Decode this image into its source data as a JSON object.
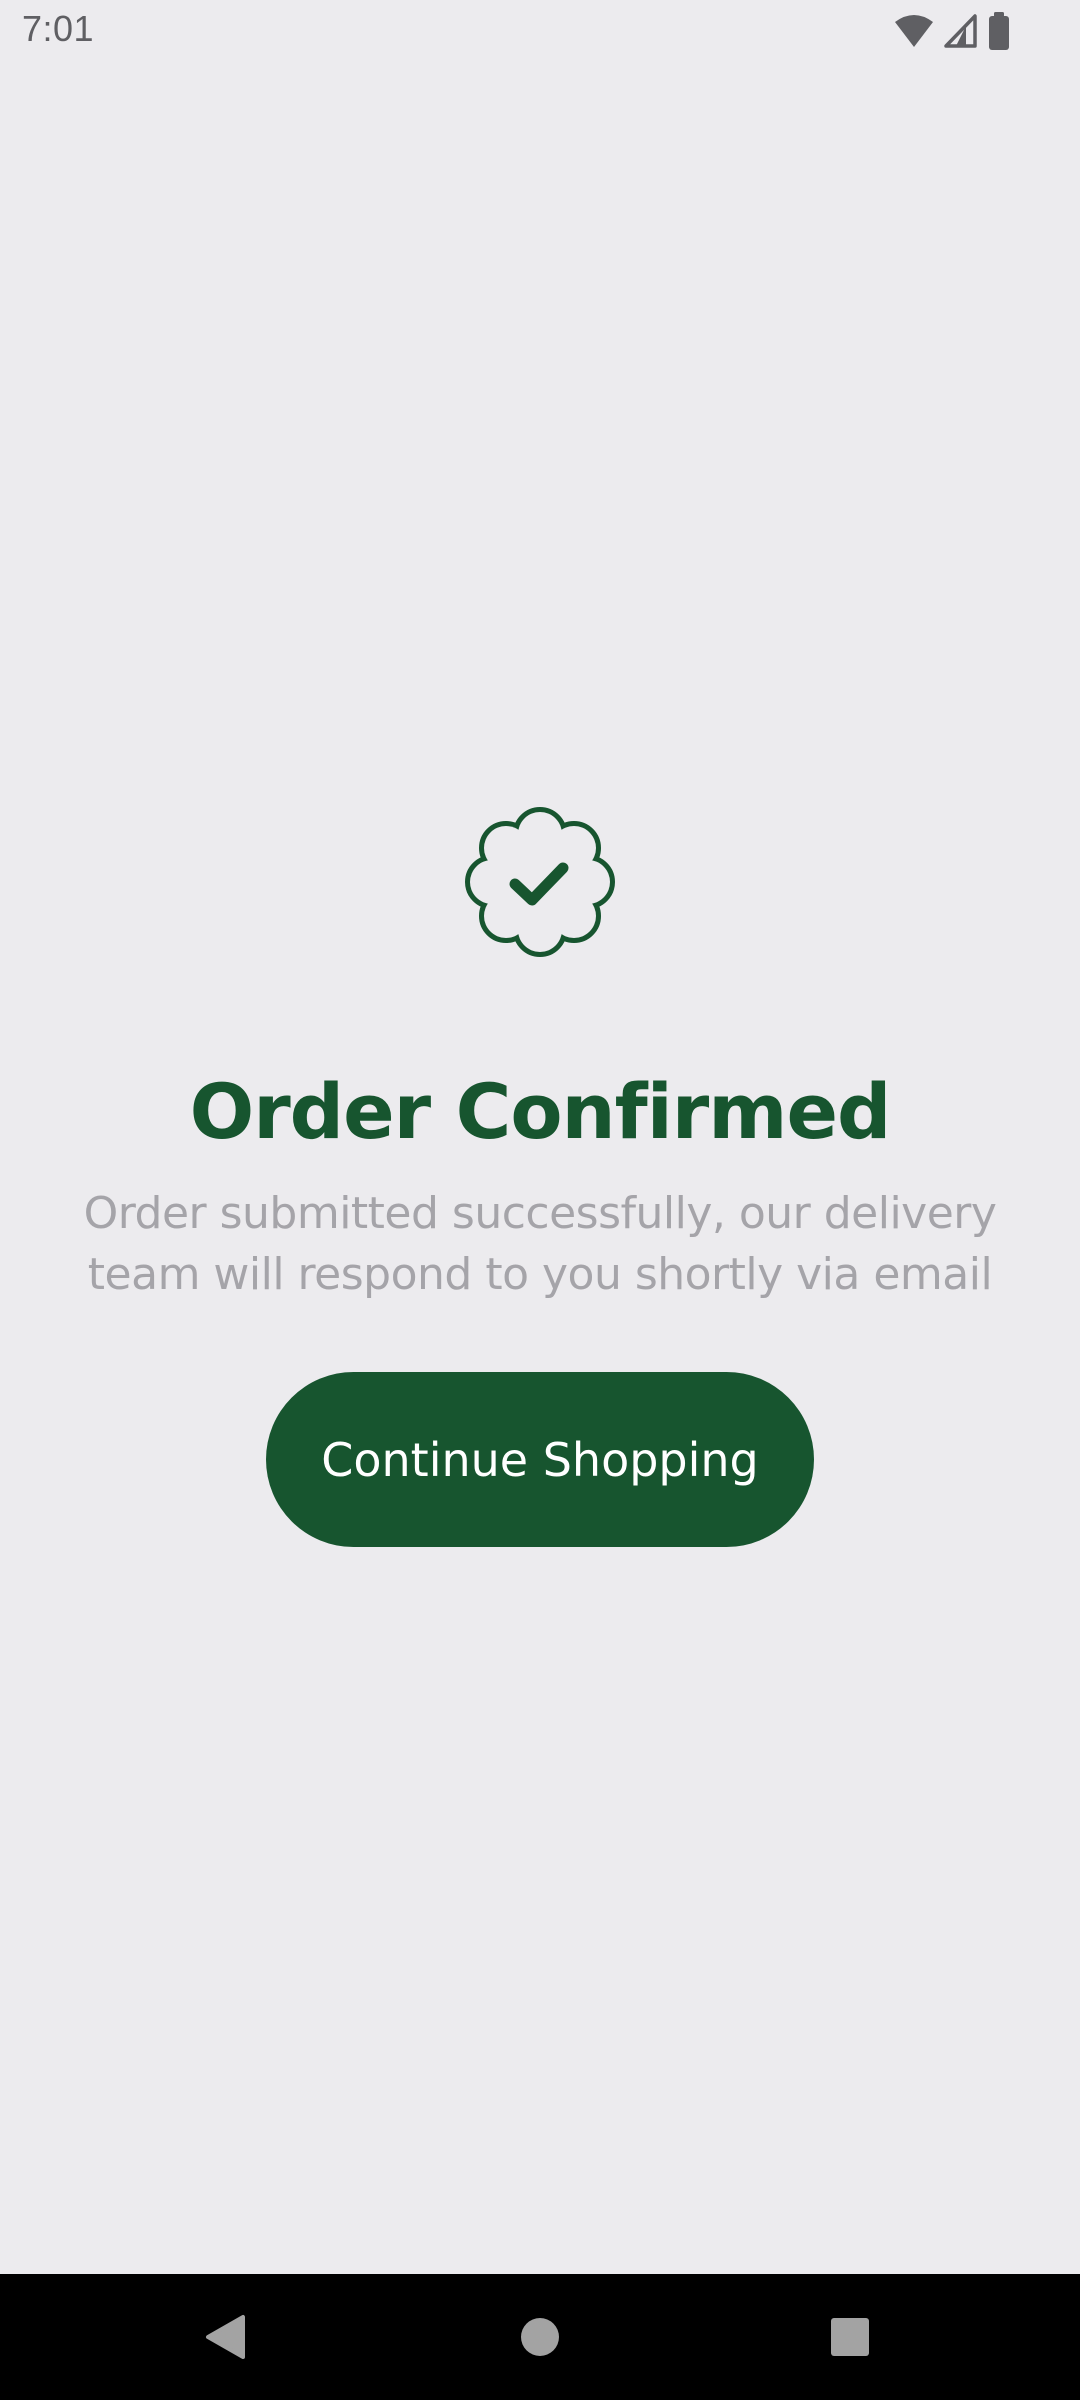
{
  "status_bar": {
    "time": "7:01",
    "icons": [
      "wifi-icon",
      "cellular-signal-icon",
      "battery-icon"
    ]
  },
  "confirmation": {
    "icon": "verified-badge-check-icon",
    "title": "Order Confirmed",
    "message": "Order submitted successfully, our delivery team will respond to you shortly via email"
  },
  "actions": {
    "continue_label": "Continue Shopping"
  },
  "navigation_bar": {
    "buttons": [
      "back-icon",
      "home-icon",
      "recents-icon"
    ]
  },
  "colors": {
    "background": "#ecebee",
    "primary": "#17552f",
    "muted_text": "#a5a4a9",
    "status_text": "#5f5f63"
  }
}
